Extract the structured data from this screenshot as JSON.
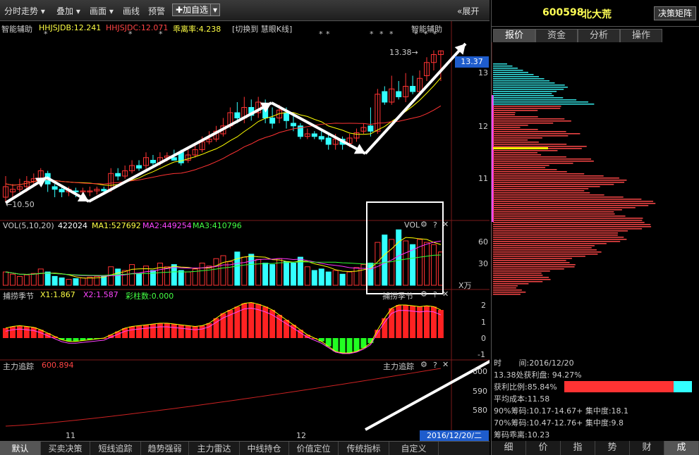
{
  "toolbar": {
    "items": [
      "分时走势",
      "叠加",
      "画面",
      "画线",
      "预警"
    ],
    "add_button": "✚加自选",
    "expand_label": "展开"
  },
  "main_chart": {
    "indicator_name": "智能辅助",
    "hhjsjdb": "HHJSJDB:12.241",
    "hhjsjdc": "HHJSJDC:12.071",
    "deviation": "乖离率:4.238",
    "switch_label": "[切换到 慧眼K线]",
    "corner_label": "智能辅助",
    "high_label": "13.38→",
    "low_label": "←10.50",
    "current_price": "13.37",
    "y_ticks": [
      "13",
      "12",
      "11"
    ]
  },
  "vol_panel": {
    "title": "VOL(5,10,20)",
    "value": "422024",
    "ma1": "MA1:527692",
    "ma2": "MA2:449254",
    "ma3": "MA3:410796",
    "corner_label": "VOL",
    "y_ticks": [
      "60",
      "30"
    ],
    "unit": "X万"
  },
  "season_panel": {
    "title": "捕捞季节",
    "x1": "X1:1.867",
    "x2": "X2:1.587",
    "bar_count": "彩柱数:0.000",
    "corner_label": "捕捞季节",
    "y_ticks": [
      "2",
      "1",
      "0",
      "-1"
    ]
  },
  "track_panel": {
    "title": "主力追踪",
    "value": "600.894",
    "corner_label": "主力追踪",
    "y_ticks": [
      "600",
      "590",
      "580"
    ]
  },
  "x_axis": {
    "labels": [
      "11",
      "12"
    ],
    "date_label": "2016/12/20/二"
  },
  "right_panel": {
    "stock_code": "600598",
    "stock_name": "北大荒",
    "decision_button": "决策矩阵",
    "tabs": [
      "报价",
      "资金",
      "分析",
      "操作"
    ],
    "y_ticks": [
      "13",
      "12",
      "11"
    ],
    "time_label": "时",
    "time_value": "间:2016/12/20",
    "profit_line": "13.38处获利盘: 94.27%",
    "profit_ratio": "获利比例:85.84%",
    "profit_ratio_value": 0.8584,
    "avg_cost": "平均成本:11.58",
    "chip90": "90%筹码:10.17-14.67+ 集中度:18.1",
    "chip70": "70%筹码:10.47-12.76+ 集中度:9.8",
    "chip_dev": "筹码乖离:10.23",
    "bottom_tabs": [
      "细",
      "价",
      "指",
      "势",
      "财",
      "成"
    ]
  },
  "bottom_tabs": [
    "默认",
    "买卖决策",
    "短线追踪",
    "趋势强弱",
    "主力雷达",
    "中线持仓",
    "价值定位",
    "传统指标",
    "自定义"
  ],
  "icons": {
    "gear": "gear-icon",
    "help": "help-icon",
    "close": "close-icon"
  },
  "colors": {
    "up": "#ff3333",
    "down": "#33ffff",
    "ma_yellow": "#ffff00",
    "ma_magenta": "#ff33ff",
    "ma_green": "#33ff33",
    "accent_blue": "#1e5ccc"
  }
}
